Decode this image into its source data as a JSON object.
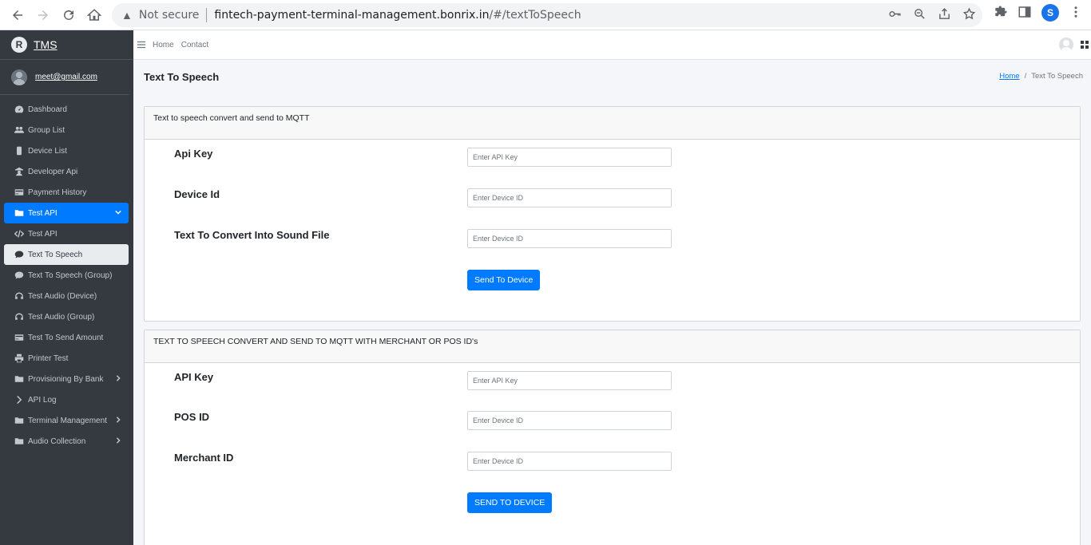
{
  "browser": {
    "security_label": "Not secure",
    "url_host": "fintech-payment-terminal-management.bonrix.in",
    "url_path": "/#/textToSpeech",
    "profile_initial": "S"
  },
  "sidebar": {
    "brand": "TMS",
    "brand_logo": "R",
    "user_email": "meet@gmail.com",
    "items": [
      {
        "label": "Dashboard",
        "icon": "dashboard-icon"
      },
      {
        "label": "Group List",
        "icon": "users-icon"
      },
      {
        "label": "Device List",
        "icon": "mobile-icon"
      },
      {
        "label": "Developer Api",
        "icon": "user-icon"
      },
      {
        "label": "Payment History",
        "icon": "credit-card-icon"
      },
      {
        "label": "Test API",
        "icon": "folder-icon"
      },
      {
        "label": "Test API",
        "icon": "code-icon"
      },
      {
        "label": "Text To Speech",
        "icon": "comment-icon"
      },
      {
        "label": "Text To Speech (Group)",
        "icon": "comment-icon"
      },
      {
        "label": "Test Audio (Device)",
        "icon": "headphones-icon"
      },
      {
        "label": "Test Audio (Group)",
        "icon": "headphones-icon"
      },
      {
        "label": "Test To Send Amount",
        "icon": "credit-card-icon"
      },
      {
        "label": "Printer Test",
        "icon": "print-icon"
      },
      {
        "label": "Provisioning By Bank",
        "icon": "folder-icon"
      },
      {
        "label": "API Log",
        "icon": "chevron-right-icon"
      },
      {
        "label": "Terminal Management",
        "icon": "folder-icon"
      },
      {
        "label": "Audio Collection",
        "icon": "folder-icon"
      }
    ]
  },
  "topbar": {
    "links": [
      "Home",
      "Contact"
    ]
  },
  "page": {
    "title": "Text To Speech",
    "breadcrumb_home": "Home",
    "breadcrumb_current": "Text To Speech"
  },
  "card1": {
    "header": "Text to speech convert and send to MQTT",
    "fields": [
      {
        "label": "Api Key",
        "placeholder": "Enter API Key",
        "value": ""
      },
      {
        "label": "Device Id",
        "placeholder": "Enter Device ID",
        "value": ""
      },
      {
        "label": "Text To Convert Into Sound File",
        "placeholder": "Enter Device ID",
        "value": ""
      }
    ],
    "button": "Send To Device"
  },
  "card2": {
    "header": "TEXT TO SPEECH CONVERT AND SEND TO MQTT WITH MERCHANT OR POS ID's",
    "fields": [
      {
        "label": "API Key",
        "placeholder": "Enter API Key",
        "value": ""
      },
      {
        "label": "POS ID",
        "placeholder": "Enter Device ID",
        "value": ""
      },
      {
        "label": "Merchant ID",
        "placeholder": "Enter Device ID",
        "value": ""
      }
    ],
    "button": "SEND TO DEVICE"
  },
  "colors": {
    "sidebar_bg": "#343a40",
    "primary": "#007bff",
    "content_bg": "#f4f6f9"
  }
}
